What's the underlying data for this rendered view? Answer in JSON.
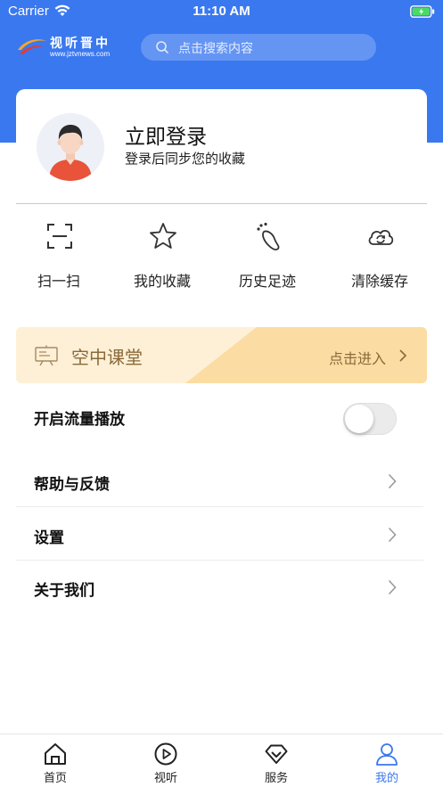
{
  "status_bar": {
    "carrier": "Carrier",
    "time": "11:10 AM"
  },
  "header": {
    "logo_title": "视听晋中",
    "logo_url": "www.jztvnews.com",
    "search_placeholder": "点击搜索内容",
    "brand_color": "#3a78f0"
  },
  "profile": {
    "title": "立即登录",
    "subtitle": "登录后同步您的收藏"
  },
  "quick_actions": [
    {
      "label": "扫一扫",
      "icon": "scan-icon"
    },
    {
      "label": "我的收藏",
      "icon": "star-icon"
    },
    {
      "label": "历史足迹",
      "icon": "footprint-icon"
    },
    {
      "label": "清除缓存",
      "icon": "cloud-refresh-icon"
    }
  ],
  "classroom": {
    "title": "空中课堂",
    "action": "点击进入",
    "icon": "presentation-board-icon"
  },
  "settings": {
    "traffic_play": {
      "label": "开启流量播放",
      "enabled": false
    },
    "items": [
      {
        "label": "帮助与反馈"
      },
      {
        "label": "设置"
      },
      {
        "label": "关于我们"
      }
    ]
  },
  "tab_bar": {
    "active_color": "#3a78f0",
    "items": [
      {
        "label": "首页",
        "icon": "home-icon",
        "active": false
      },
      {
        "label": "视听",
        "icon": "play-circle-icon",
        "active": false
      },
      {
        "label": "服务",
        "icon": "diamond-heart-icon",
        "active": false
      },
      {
        "label": "我的",
        "icon": "user-icon",
        "active": true
      }
    ]
  }
}
